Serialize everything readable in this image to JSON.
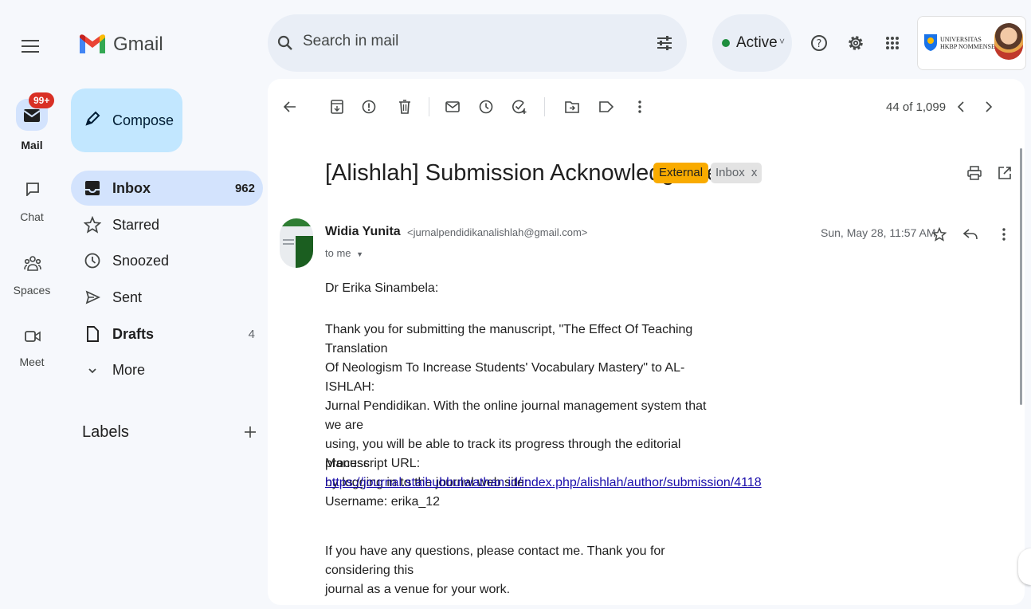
{
  "app": {
    "name": "Gmail"
  },
  "search": {
    "placeholder": "Search in mail"
  },
  "status": {
    "label": "Active",
    "color": "#1e8e3e"
  },
  "account": {
    "org_line1": "UNIVERSITAS",
    "org_line2": "HKBP NOMMENSEN"
  },
  "rail": {
    "mail_badge": "99+",
    "items": [
      {
        "label": "Mail",
        "icon": "mail-icon"
      },
      {
        "label": "Chat",
        "icon": "chat-icon"
      },
      {
        "label": "Spaces",
        "icon": "spaces-icon"
      },
      {
        "label": "Meet",
        "icon": "meet-icon"
      }
    ]
  },
  "compose": {
    "label": "Compose"
  },
  "nav": {
    "items": [
      {
        "label": "Inbox",
        "count": "962",
        "icon": "inbox-icon",
        "active": true
      },
      {
        "label": "Starred",
        "count": "",
        "icon": "star-icon"
      },
      {
        "label": "Snoozed",
        "count": "",
        "icon": "clock-icon"
      },
      {
        "label": "Sent",
        "count": "",
        "icon": "send-icon"
      },
      {
        "label": "Drafts",
        "count": "4",
        "icon": "draft-icon"
      },
      {
        "label": "More",
        "count": "",
        "icon": "chevron-down-icon"
      }
    ],
    "labels_heading": "Labels"
  },
  "toolbar": {
    "pagination": "44 of 1,099"
  },
  "message": {
    "subject": "[Alishlah] Submission Acknowledgement",
    "chip_external": "External",
    "chip_inbox": "Inbox",
    "chip_close": "x",
    "sender_name": "Widia Yunita",
    "sender_email": "<jurnalpendidikanalishlah@gmail.com>",
    "recipient": "to me",
    "date": "Sun, May 28, 11:57 AM",
    "greeting": "Dr Erika Sinambela:",
    "para1": [
      "Thank you for submitting the manuscript, \"The Effect Of Teaching Translation",
      "Of Neologism To Increase Students' Vocabulary Mastery\" to AL-ISHLAH:",
      "Jurnal Pendidikan. With the online journal management system that we are",
      "using, you will be able to track its progress through the editorial process",
      "by logging in to the journal web site:"
    ],
    "url_label": "Manuscript URL:",
    "url": "https://journal.staihubbulwathan.id/index.php/alishlah/author/submission/4118",
    "username": "Username: erika_12",
    "para2": [
      "If you have any questions, please contact me. Thank you for considering this",
      "journal as a venue for your work."
    ]
  }
}
